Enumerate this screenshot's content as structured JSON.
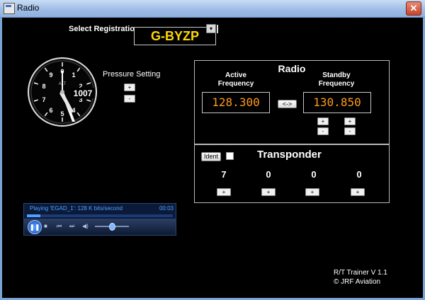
{
  "window": {
    "title": "Radio",
    "close_glyph": "✕"
  },
  "registration": {
    "label": "Select Registration",
    "value": "G-BYZP",
    "dropdown_glyph": "▾"
  },
  "altimeter": {
    "pressure_label": "Pressure Setting",
    "pressure_value": "1007",
    "plus": "+",
    "minus": "-",
    "dial_label": "ALT",
    "dial_numbers": [
      "0",
      "1",
      "2",
      "3",
      "4",
      "5",
      "6",
      "7",
      "8",
      "9"
    ]
  },
  "radio": {
    "title": "Radio",
    "active_label_line1": "Active",
    "active_label_line2": "Frequency",
    "standby_label_line1": "Standby",
    "standby_label_line2": "Frequency",
    "active_freq": "128.300",
    "standby_freq": "130.850",
    "swap_label": "<->",
    "plus": "+",
    "minus": "-"
  },
  "transponder": {
    "title": "Transponder",
    "ident_label": "Ident",
    "digits": [
      "7",
      "0",
      "0",
      "0"
    ],
    "plus": "+"
  },
  "media_player": {
    "status": "Playing 'EGAD_1': 128 K bits/second",
    "time": "00:03",
    "play_glyph": "❚❚",
    "stop_glyph": "■",
    "prev_glyph": "⏮",
    "next_glyph": "⏭",
    "volume_glyph": "◀)",
    "progress": 0.09
  },
  "footer": {
    "line1": "R/T Trainer V 1.1",
    "line2": "© JRF Aviation"
  }
}
